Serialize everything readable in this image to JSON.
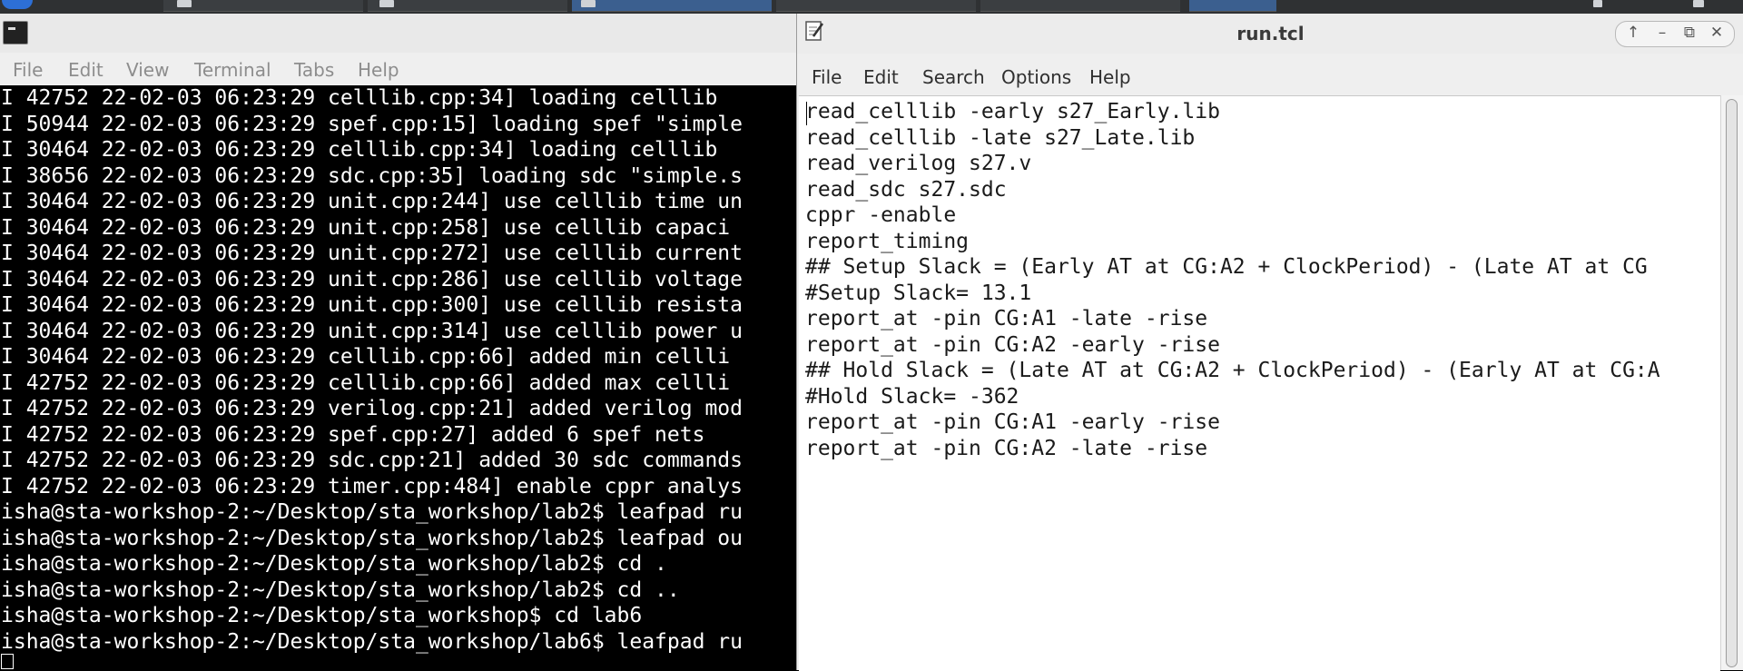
{
  "terminal": {
    "menu": [
      "File",
      "Edit",
      "View",
      "Terminal",
      "Tabs",
      "Help"
    ],
    "lines": [
      "I 42752 22-02-03 06:23:29 celllib.cpp:34] loading celllib",
      "I 50944 22-02-03 06:23:29 spef.cpp:15] loading spef \"simple",
      "I 30464 22-02-03 06:23:29 celllib.cpp:34] loading celllib",
      "I 38656 22-02-03 06:23:29 sdc.cpp:35] loading sdc \"simple.s",
      "I 30464 22-02-03 06:23:29 unit.cpp:244] use celllib time un",
      "I 30464 22-02-03 06:23:29 unit.cpp:258] use celllib capaci",
      "I 30464 22-02-03 06:23:29 unit.cpp:272] use celllib current",
      "I 30464 22-02-03 06:23:29 unit.cpp:286] use celllib voltage",
      "I 30464 22-02-03 06:23:29 unit.cpp:300] use celllib resista",
      "I 30464 22-02-03 06:23:29 unit.cpp:314] use celllib power u",
      "I 30464 22-02-03 06:23:29 celllib.cpp:66] added min cellli",
      "I 42752 22-02-03 06:23:29 celllib.cpp:66] added max cellli",
      "I 42752 22-02-03 06:23:29 verilog.cpp:21] added verilog mod",
      "I 42752 22-02-03 06:23:29 spef.cpp:27] added 6 spef nets",
      "I 42752 22-02-03 06:23:29 sdc.cpp:21] added 30 sdc commands",
      "I 42752 22-02-03 06:23:29 timer.cpp:484] enable cppr analys",
      "isha@sta-workshop-2:~/Desktop/sta_workshop/lab2$ leafpad ru",
      "isha@sta-workshop-2:~/Desktop/sta_workshop/lab2$ leafpad ou",
      "isha@sta-workshop-2:~/Desktop/sta_workshop/lab2$ cd .",
      "isha@sta-workshop-2:~/Desktop/sta_workshop/lab2$ cd ..",
      "isha@sta-workshop-2:~/Desktop/sta_workshop$ cd lab6",
      "isha@sta-workshop-2:~/Desktop/sta_workshop/lab6$ leafpad ru"
    ]
  },
  "editor": {
    "title": "run.tcl",
    "controls": {
      "up": "↑",
      "minimize": "–",
      "maximize": "⧉",
      "close": "✕"
    },
    "menu": [
      "File",
      "Edit",
      "Search",
      "Options",
      "Help"
    ],
    "lines": [
      "read_celllib -early s27_Early.lib",
      "read_celllib -late s27_Late.lib",
      "read_verilog s27.v",
      "read_sdc s27.sdc",
      "cppr -enable",
      "report_timing",
      "## Setup Slack = (Early AT at CG:A2 + ClockPeriod) - (Late AT at CG",
      "#Setup Slack= 13.1",
      "report_at -pin CG:A1 -late -rise",
      "report_at -pin CG:A2 -early -rise",
      "## Hold Slack = (Late AT at CG:A2 + ClockPeriod) - (Early AT at CG:A",
      "#Hold Slack= -362",
      "report_at -pin CG:A1 -early -rise",
      "report_at -pin CG:A2 -late -rise"
    ]
  },
  "icons": {
    "terminal": "terminal-icon",
    "editor": "leafpad-icon",
    "start": "start-menu-icon"
  }
}
